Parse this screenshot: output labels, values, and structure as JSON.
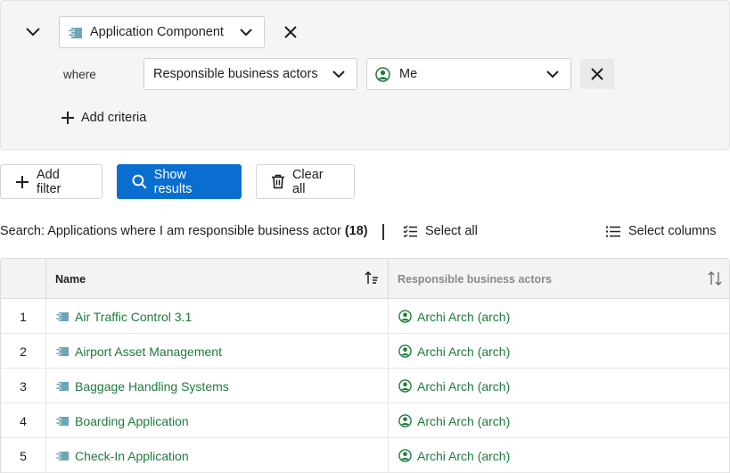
{
  "filter": {
    "type_value": "Application Component",
    "where_label": "where",
    "attribute_value": "Responsible business actors",
    "value_value": "Me",
    "add_criteria_label": "Add criteria"
  },
  "actions": {
    "add_filter_label": "Add filter",
    "show_results_label": "Show results",
    "clear_all_label": "Clear all"
  },
  "summary": {
    "text": "Search: Applications where I am responsible business actor",
    "count": "(18)",
    "select_all_label": "Select all",
    "select_columns_label": "Select columns"
  },
  "table": {
    "columns": [
      "Name",
      "Responsible business actors"
    ],
    "rows": [
      {
        "index": "1",
        "name": "Air Traffic Control 3.1",
        "actor": "Archi Arch (arch)"
      },
      {
        "index": "2",
        "name": "Airport Asset Management",
        "actor": "Archi Arch (arch)"
      },
      {
        "index": "3",
        "name": "Baggage Handling Systems",
        "actor": "Archi Arch (arch)"
      },
      {
        "index": "4",
        "name": "Boarding Application",
        "actor": "Archi Arch (arch)"
      },
      {
        "index": "5",
        "name": "Check-In Application",
        "actor": "Archi Arch (arch)"
      }
    ]
  },
  "colors": {
    "primary": "#0a6ed1",
    "link": "#1f7a3b",
    "app_icon": "#6ba6b8",
    "user_icon": "#1f7a3b"
  },
  "icons": {
    "collapse": "chevron-down-icon",
    "app": "application-component-icon",
    "user": "user-icon",
    "close": "close-icon",
    "add": "plus-icon",
    "search": "search-icon",
    "trash": "trash-icon",
    "select_all": "checklist-icon",
    "columns": "list-icon",
    "sort_asc": "sort-ascending-icon",
    "sort": "sort-icon"
  }
}
